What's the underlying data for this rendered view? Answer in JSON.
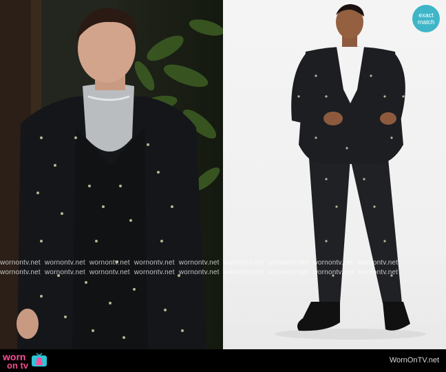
{
  "badge": {
    "line1": "exact",
    "line2": "match",
    "color": "#3fb6c8"
  },
  "watermark": {
    "text": "wornontv.net",
    "row1": [
      "wornontv.net",
      "wornontv.net",
      "wornontv.net",
      "wornontv.net",
      "wornontv.net",
      "wornontv.net",
      "wornontv.net",
      "wornontv.net",
      "wornontv.net"
    ],
    "row2": [
      "wornontv.net",
      "wornontv.net",
      "wornontv.net",
      "wornontv.net",
      "wornontv.net",
      "wornontv.net",
      "wornontv.net",
      "wornontv.net",
      "wornontv.net"
    ]
  },
  "footer": {
    "brand_line1": "worn",
    "brand_line2": "on tv",
    "site": "WornOnTV.net",
    "brand_color": "#ff4f9a",
    "background": "#000000"
  },
  "images": {
    "left": "actor in black floral-print tuxedo suit with silver turtleneck",
    "right": "model in matching black printed suit on white background"
  }
}
